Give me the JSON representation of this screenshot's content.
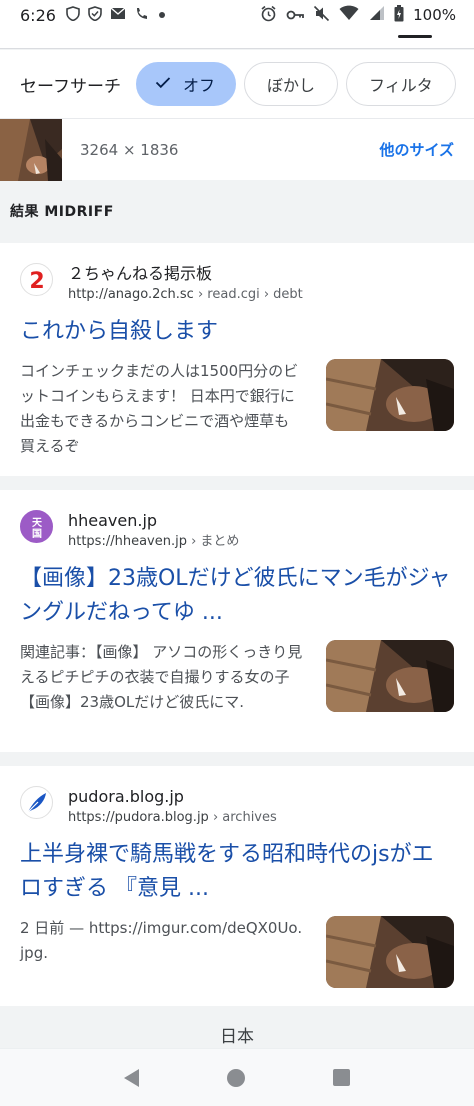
{
  "status_bar": {
    "time": "6:26",
    "battery": "100%"
  },
  "safesearch": {
    "label": "セーフサーチ",
    "options": [
      {
        "label": "オフ",
        "selected": true
      },
      {
        "label": "ぼかし",
        "selected": false
      },
      {
        "label": "フィルタ",
        "selected": false
      }
    ]
  },
  "image_info": {
    "size": "3264 × 1836",
    "other_sizes_label": "他のサイズ"
  },
  "results_header": "結果 MIDRIFF",
  "results": [
    {
      "site_name": "２ちゃんねる掲示板",
      "url": "http://anago.2ch.sc",
      "url_path": " › read.cgi › debt",
      "title": "これから自殺します",
      "snippet": "コインチェックまだの人は1500円分のビットコインもらえます！ 日本円で銀行に出金もできるからコンビニで酒や煙草も買えるぞ",
      "favicon_icon": "2ch-logo-icon"
    },
    {
      "site_name": "hheaven.jp",
      "url": "https://hheaven.jp",
      "url_path": " › まとめ",
      "title": "【画像】23歳OLだけど彼氏にマン毛がジャングルだねってゆ ...",
      "snippet": "関連記事：【画像】 アソコの形くっきり見えるピチピチの衣装で自撮りする女の子 【画像】23歳OLだけど彼氏にマ.",
      "favicon_icon": "tengoku-logo-icon"
    },
    {
      "site_name": "pudora.blog.jp",
      "url": "https://pudora.blog.jp",
      "url_path": " › archives",
      "title": "上半身裸で騎馬戦をする昭和時代のjsがエロすぎる 『意見 ...",
      "snippet": "2 日前 — https://imgur.com/deQX0Uo.jpg.",
      "favicon_icon": "feather-logo-icon"
    }
  ],
  "footer": {
    "language": "日本"
  },
  "colors": {
    "link": "#1a4fa8",
    "accent": "#1a73e8",
    "chip_selected": "#a8c7fa"
  }
}
